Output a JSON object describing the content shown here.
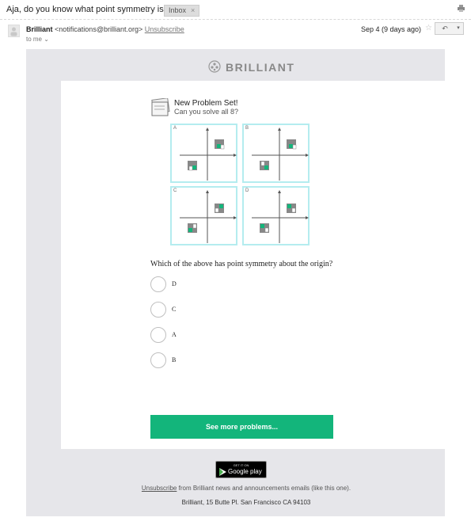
{
  "email": {
    "subject": "Aja, do you know what point symmetry is?",
    "label": "Inbox",
    "label_close": "×",
    "sender_name": "Brilliant",
    "sender_email": "<notifications@brilliant.org>",
    "unsubscribe": "Unsubscribe",
    "to": "to me",
    "date": "Sep 4 (9 days ago)",
    "reply_icon": "reply-icon",
    "more_icon": "chevron-down-icon"
  },
  "content": {
    "brand": "BRILLIANT",
    "problem_set_title": "New Problem Set!",
    "problem_set_subtitle": "Can you solve all 8?",
    "graphs": [
      {
        "label": "A"
      },
      {
        "label": "B"
      },
      {
        "label": "C"
      },
      {
        "label": "D"
      }
    ],
    "question": "Which of the above has point symmetry about the origin?",
    "options": [
      "D",
      "C",
      "A",
      "B"
    ],
    "cta": "See more problems..."
  },
  "footer": {
    "google_play_top": "GET IT ON",
    "google_play": "Google play",
    "unsubscribe": "Unsubscribe",
    "from_text": "from",
    "brand": "Brilliant",
    "rest_text": "news and announcements emails (like this one).",
    "address_brand": "Brilliant",
    "address": ", 15 Butte Pl. San Francisco CA 94103"
  },
  "colors": {
    "accent_green": "#13b57b",
    "graph_border": "#b4ecef",
    "email_bg": "#e6e6ea"
  }
}
